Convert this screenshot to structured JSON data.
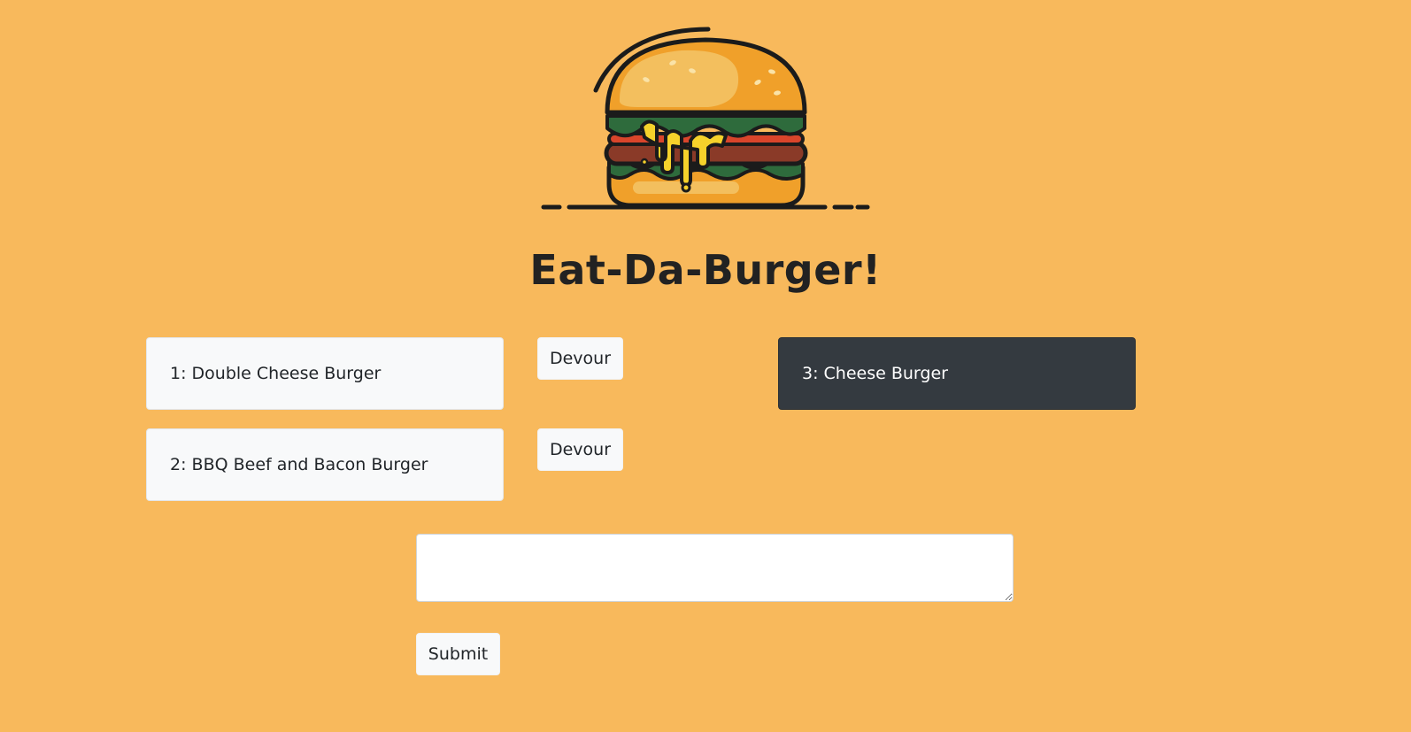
{
  "header": {
    "logo_icon": "burger-icon",
    "title": "Eat-Da-Burger!"
  },
  "burgers_to_eat": [
    {
      "label": "1: Double Cheese Burger",
      "button_label": "Devour"
    },
    {
      "label": "2: BBQ Beef and Bacon Burger",
      "button_label": "Devour"
    }
  ],
  "devoured_burgers": [
    {
      "label": "3: Cheese Burger"
    }
  ],
  "form": {
    "textarea_value": "",
    "submit_label": "Submit"
  },
  "colors": {
    "background": "#f8b95c",
    "card_light": "#f8f9fa",
    "card_dark": "#343a40"
  }
}
